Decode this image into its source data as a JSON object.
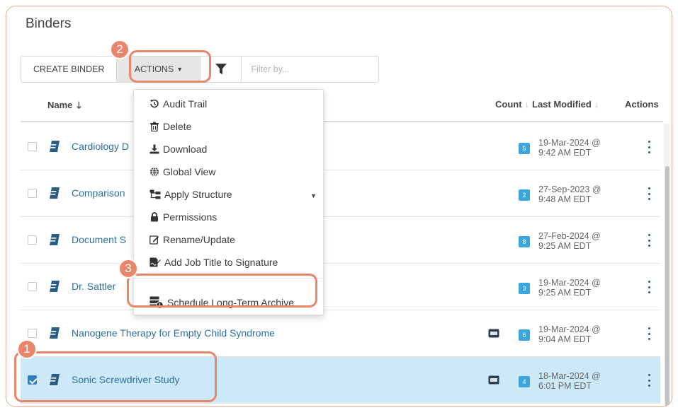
{
  "page": {
    "title": "Binders"
  },
  "toolbar": {
    "create_label": "CREATE BINDER",
    "actions_label": "ACTIONS",
    "filter_placeholder": "Filter by..."
  },
  "columns": {
    "name": "Name",
    "count": "Count",
    "last_modified": "Last Modified",
    "actions": "Actions"
  },
  "rows": [
    {
      "name": "Cardiology D",
      "count": "5",
      "modified_date": "19-Mar-2024 @",
      "modified_time": "9:42 AM EDT",
      "selected": false,
      "archive_icon": false
    },
    {
      "name": "Comparison",
      "count": "2",
      "modified_date": "27-Sep-2023 @",
      "modified_time": "9:48 AM EDT",
      "selected": false,
      "archive_icon": false
    },
    {
      "name": "Document S",
      "count": "8",
      "modified_date": "27-Feb-2024 @",
      "modified_time": "9:25 AM EDT",
      "selected": false,
      "archive_icon": false
    },
    {
      "name": "Dr. Sattler",
      "count": "3",
      "modified_date": "19-Mar-2024 @",
      "modified_time": "9:25 AM EDT",
      "selected": false,
      "archive_icon": false
    },
    {
      "name": "Nanogene Therapy for Empty Child Syndrome",
      "count": "6",
      "modified_date": "19-Mar-2024 @",
      "modified_time": "9:04 AM EDT",
      "selected": false,
      "archive_icon": true
    },
    {
      "name": "Sonic Screwdriver Study",
      "count": "4",
      "modified_date": "18-Mar-2024 @",
      "modified_time": "6:01 PM EDT",
      "selected": true,
      "archive_icon": true
    }
  ],
  "actions_menu": {
    "items": [
      {
        "label": "Audit Trail",
        "icon": "history-icon"
      },
      {
        "label": "Delete",
        "icon": "trash-icon"
      },
      {
        "label": "Download",
        "icon": "download-icon"
      },
      {
        "label": "Global View",
        "icon": "globe-icon"
      },
      {
        "label": "Apply Structure",
        "icon": "structure-icon"
      },
      {
        "label": "Permissions",
        "icon": "lock-icon"
      },
      {
        "label": "Rename/Update",
        "icon": "edit-icon"
      },
      {
        "label": "Add Job Title to Signature",
        "icon": "signature-icon"
      },
      {
        "label": "Schedule Long-Term Archive",
        "icon": "archive-schedule-icon"
      }
    ]
  },
  "callouts": [
    "1",
    "2",
    "3"
  ],
  "colors": {
    "accent": "#e8856b",
    "link": "#2d6f9f",
    "badge": "#3aa6dc",
    "selected_row": "#cde9f7"
  }
}
